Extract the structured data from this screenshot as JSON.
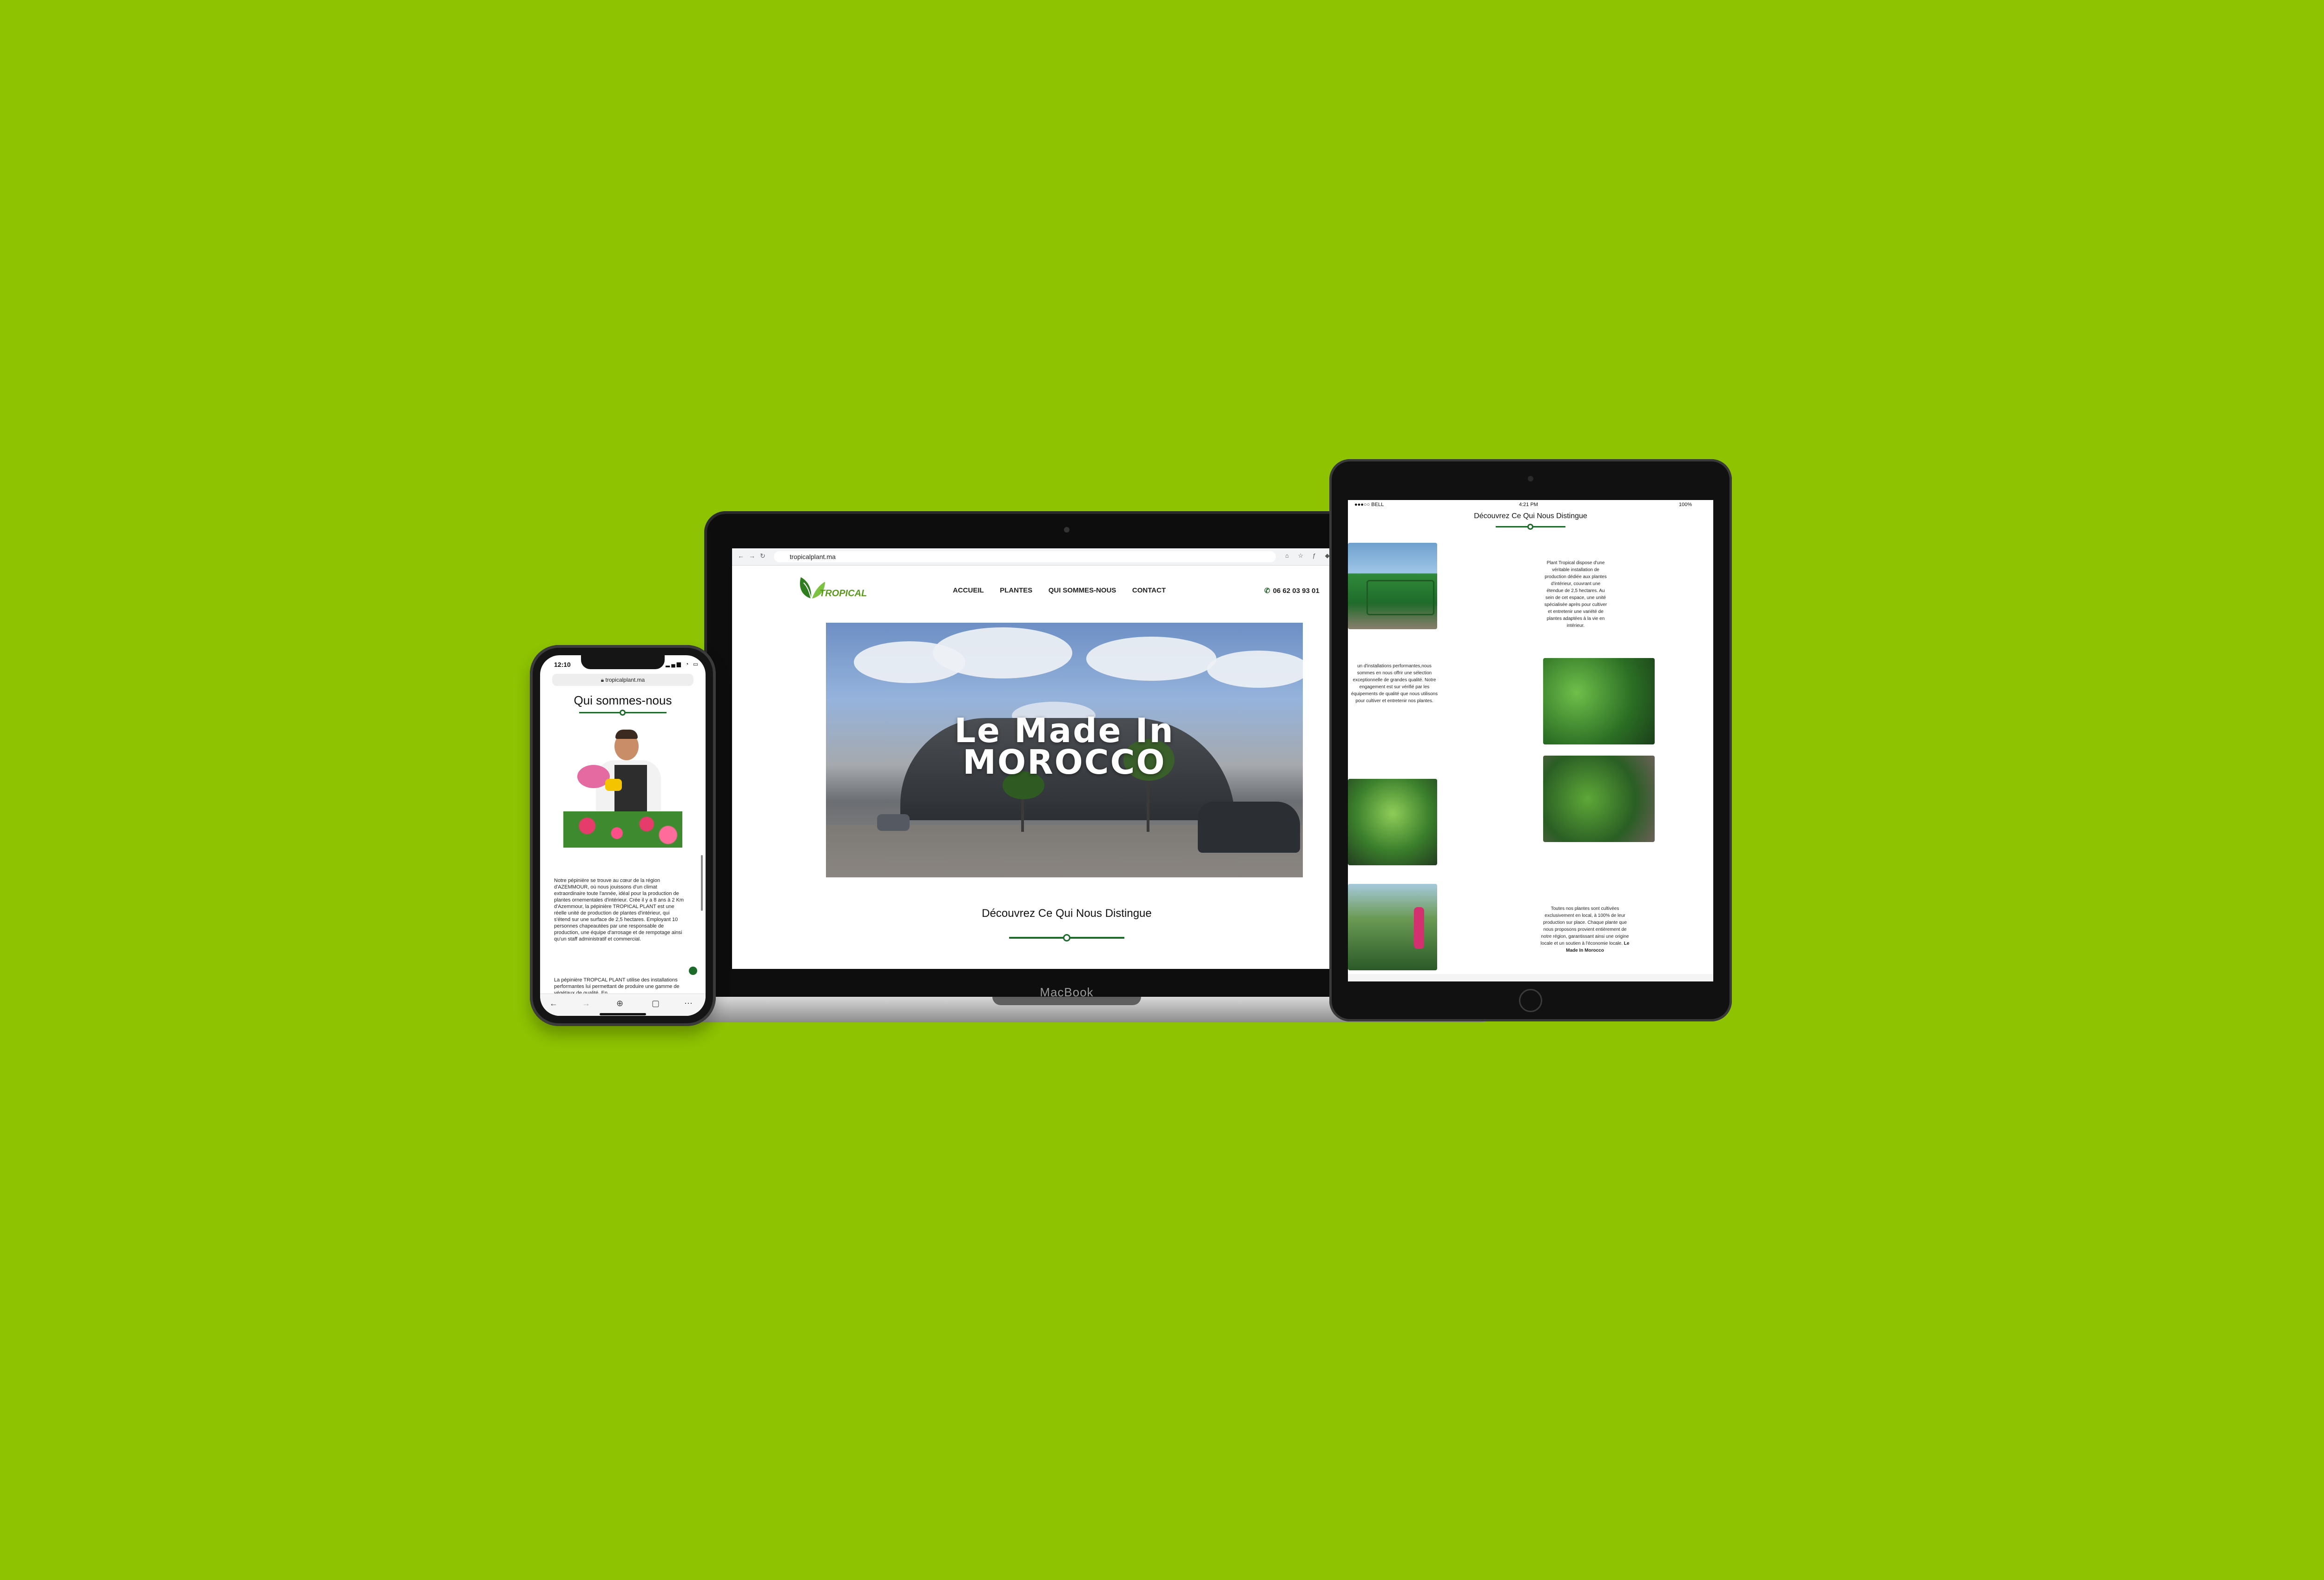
{
  "background_color": "#8dc300",
  "brand_green": "#1d6b2a",
  "laptop": {
    "brand": "MacBook",
    "browser": {
      "url": "tropicalplant.ma",
      "nav_icons": [
        "back-icon",
        "forward-icon",
        "reload-icon"
      ]
    },
    "site": {
      "logo_text": "TROPICAL",
      "nav": [
        "ACCUEIL",
        "PLANTES",
        "QUI SOMMES-NOUS",
        "CONTACT"
      ],
      "phone": "06 62 03 93 01",
      "hero_line1": "Le Made In",
      "hero_line2": "MOROCCO",
      "section_title": "Découvrez Ce Qui Nous Distingue"
    }
  },
  "tablet": {
    "status_left": "●●●○○ BELL",
    "status_time": "4:21 PM",
    "status_right": "100%",
    "title": "Découvrez Ce Qui Nous Distingue",
    "text1": "Plant Tropical dispose d'une véritable installation de production dédiée aux plantes d'intérieur, couvrant une étendue de 2,5 hectares. Au sein de cet espace, une unité spécialisée après pour cultiver et entretenir une variété de plantes adaptées à la vie en intérieur.",
    "text2": "un d'installations performantes,nous sommes en nous offrir une sélection exceptionnelle de grandes qualité. Notre engagement est sur vérifié par les équipements de qualité que nous utilisons pour cultiver et entretenir nos plantes.",
    "text3": "Toutes nos plantes sont cultivées exclusivement en local, à 100% de leur production sur place. Chaque plante que nous proposons provient entièrement de notre région, garantissant ainsi une origine locale et un soutien à l'économie locale.",
    "text3_bold": "Le Made In Morocco"
  },
  "phone": {
    "time": "12:10",
    "url": "tropicalplant.ma",
    "title": "Qui sommes-nous",
    "paragraph1": "Notre pépinière se trouve au cœur de la région d'AZEMMOUR, où nous jouissons d'un climat extraordinaire toute l'année, idéal pour la production de plantes ornementales d'intérieur. Crée il y a 8 ans à 2 Km d'Azemmour, la pépinière TROPICAL PLANT est une réelle unité de production de plantes d'intérieur, qui s'étend sur une surface de 2,5 hectares. Employant 10 personnes chapeautées par une responsable de production, une équipe d'arrosage et de rempotage ainsi qu'un staff administratif et commercial.",
    "paragraph2": "La pépinière TROPCAL PLANT utilise des installations performantes lui permettant de produire une gamme de végétaux de qualité. En"
  }
}
